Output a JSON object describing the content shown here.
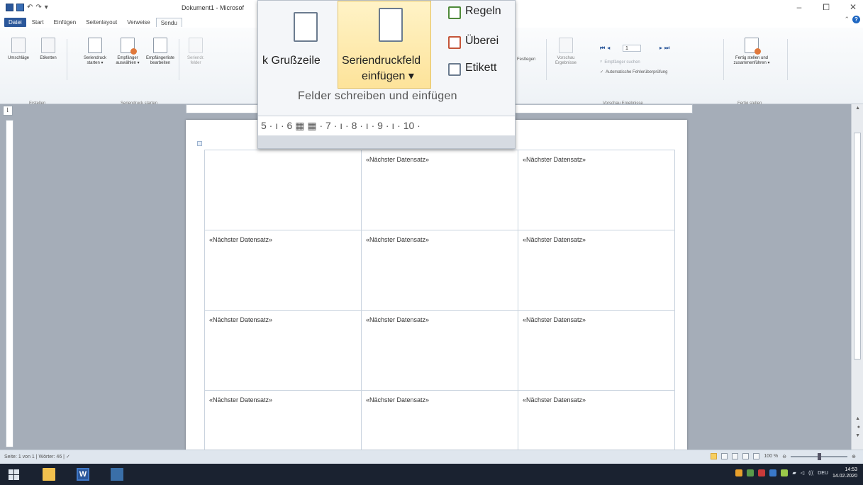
{
  "window": {
    "title": "Dokument1 - Microsof",
    "controls": {
      "minimize": "–",
      "maximize": "⧠",
      "close": "✕"
    }
  },
  "tabs": [
    {
      "label": "Datei",
      "state": "file"
    },
    {
      "label": "Start",
      "state": ""
    },
    {
      "label": "Einfügen",
      "state": ""
    },
    {
      "label": "Seitenlayout",
      "state": ""
    },
    {
      "label": "Verweise",
      "state": ""
    },
    {
      "label": "Sendu",
      "state": "active"
    }
  ],
  "ribbon": {
    "buttons": {
      "envelopes": "Umschläge",
      "labels": "Etiketten",
      "start_merge": "Seriendruck starten ▾",
      "select_recipients": "Empfänger auswählen ▾",
      "edit_recipients": "Empfängerliste bearbeiten",
      "highlight_fields": "Seriendr. felder",
      "match_fields": "Festlegen",
      "preview_results": "Vorschau Ergebnisse",
      "find_recipient": "Empfänger suchen",
      "auto_check": "Automatische Fehlerüberprüfung",
      "finish_merge": "Fertig stellen und zusammenführen ▾"
    },
    "groups": {
      "create": "Erstellen",
      "start_merge": "Seriendruck starten",
      "preview": "Vorschau Ergebnisse",
      "finish": "Fertig stellen"
    },
    "record_number": "1"
  },
  "zoom": {
    "greeting_line": "k Grußzeile",
    "insert_merge_field_line1": "Seriendruckfeld",
    "insert_merge_field_line2": "einfügen ▾",
    "rules": "Regeln",
    "match": "Überei",
    "update_labels": "Etikett",
    "group_label": "Felder schreiben und einfügen",
    "ruler_text": "5 · ı · 6 ▦ ▦ · 7 · ı · 8 · ı · 9 · ı · 10 ·"
  },
  "document": {
    "labels": [
      [
        "",
        "«Nächster Datensatz»",
        "«Nächster Datensatz»"
      ],
      [
        "«Nächster Datensatz»",
        "«Nächster Datensatz»",
        "«Nächster Datensatz»"
      ],
      [
        "«Nächster Datensatz»",
        "«Nächster Datensatz»",
        "«Nächster Datensatz»"
      ],
      [
        "«Nächster Datensatz»",
        "«Nächster Datensatz»",
        "«Nächster Datensatz»"
      ]
    ]
  },
  "statusbar": {
    "page": "Seite: 1 von 1",
    "words": "Wörter: 46",
    "zoom": "100 %",
    "zoom_level_percent": 100
  },
  "taskbar": {
    "time": "14:53",
    "date": "14.02.2020",
    "volume": "(((",
    "language": "DEU"
  },
  "colors": {
    "word_blue": "#2b579a",
    "merge_highlight": "#fde39a",
    "taskbar": "#1a2230"
  }
}
